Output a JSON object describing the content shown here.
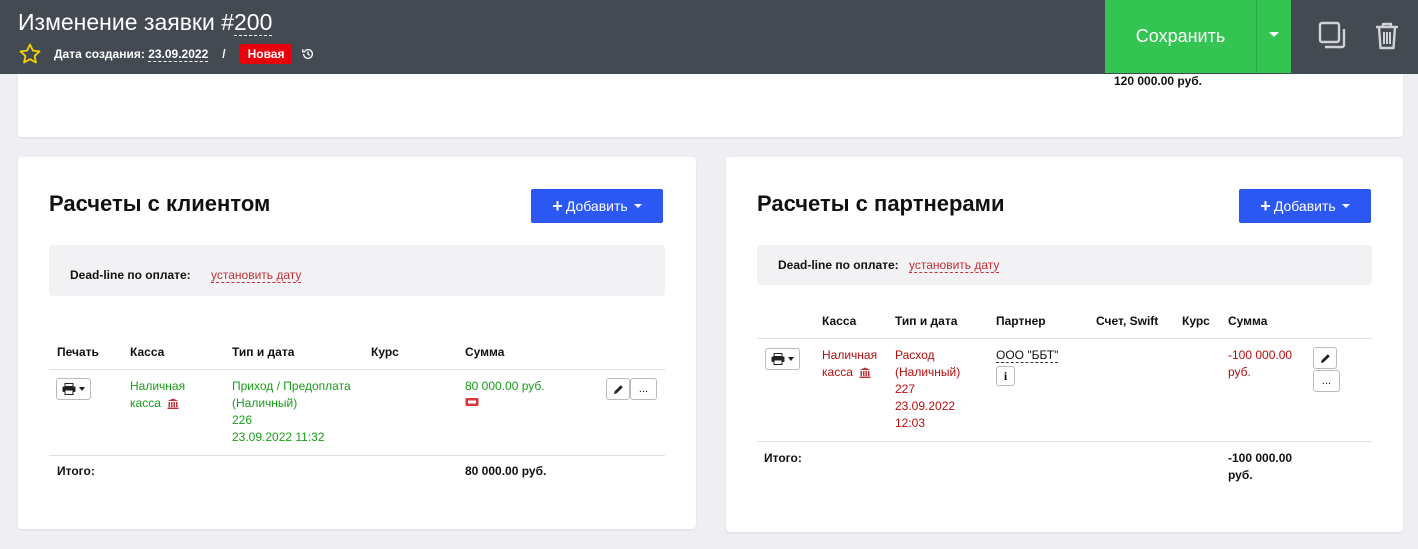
{
  "header": {
    "title_prefix": "Изменение заявки #",
    "title_number": "200",
    "created_label": "Дата создания:",
    "created_date": "23.09.2022",
    "separator": "/",
    "status_badge": "Новая",
    "save_label": "Сохранить",
    "colors": {
      "bar": "#444a52",
      "save": "#33c451",
      "badge": "#e8000b"
    }
  },
  "top_card": {
    "total": "120 000.00 руб."
  },
  "client": {
    "title": "Расчеты с клиентом",
    "add_label": "Добавить",
    "deadline_label": "Dead-line по оплате:",
    "deadline_link": "установить дату",
    "columns": [
      "Печать",
      "Касса",
      "Тип и дата",
      "Курс",
      "Сумма"
    ],
    "row": {
      "kassa_line1": "Наличная",
      "kassa_line2": "касса",
      "type_line1": "Приход / Предоплата",
      "type_line2": "(Наличный)",
      "type_line3": "226",
      "type_line4": "23.09.2022 11:32",
      "amount": "80 000.00 руб.",
      "more_label": "..."
    },
    "total_label": "Итого:",
    "total_value": "80 000.00 руб."
  },
  "partners": {
    "title": "Расчеты с партнерами",
    "add_label": "Добавить",
    "deadline_label": "Dead-line по оплате:",
    "deadline_link": "установить дату",
    "columns": [
      "Касса",
      "Тип и дата",
      "Партнер",
      "Счет, Swift",
      "Курс",
      "Сумма"
    ],
    "row": {
      "kassa_line1": "Наличная",
      "kassa_line2": "касса",
      "type_line1": "Расход",
      "type_line2": "(Наличный)",
      "type_line3": "227",
      "type_line4": "23.09.2022",
      "type_line5": "12:03",
      "partner": "ООО \"ББТ\"",
      "info_label": "i",
      "amount_line1": "-100 000.00",
      "amount_line2": "руб.",
      "more_label": "..."
    },
    "total_label": "Итого:",
    "total_line1": "-100 000.00",
    "total_line2": "руб."
  }
}
